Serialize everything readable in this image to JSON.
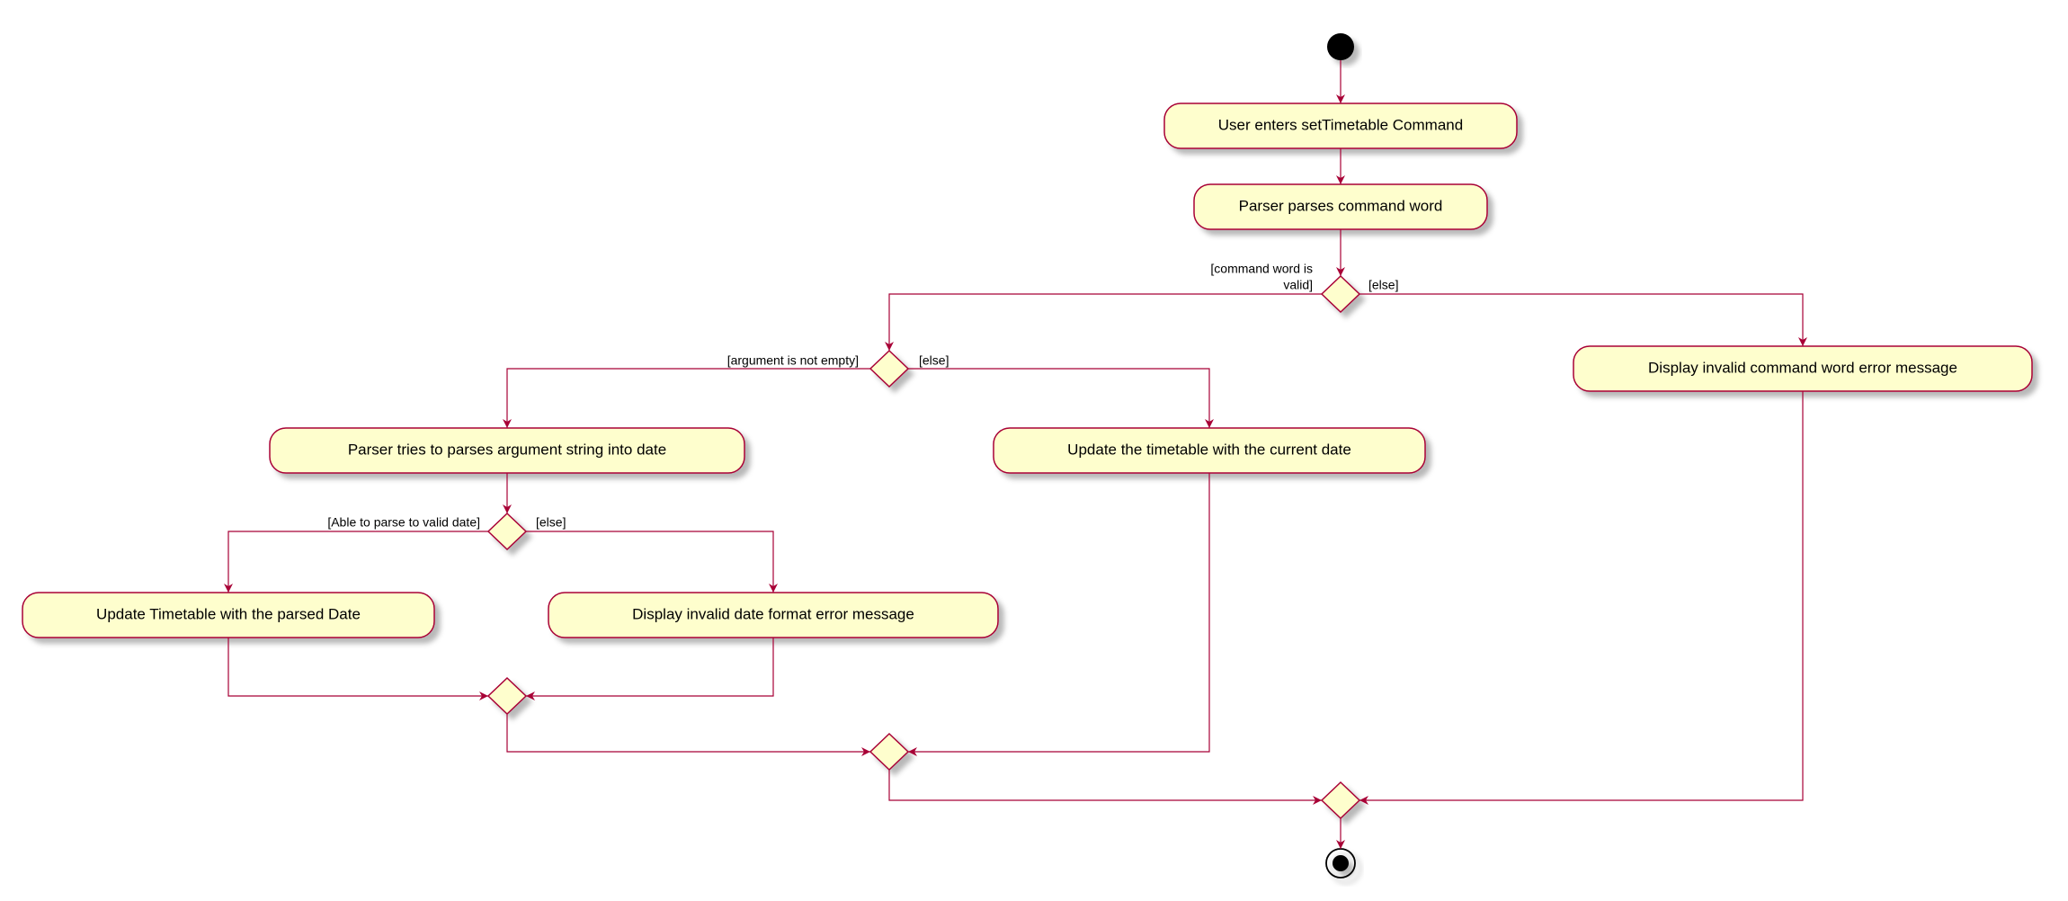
{
  "nodes": {
    "n1": "User enters setTimetable Command",
    "n2": "Parser parses command word",
    "n3": "Parser tries to parses argument string into date",
    "n4": "Update the timetable with the current date",
    "n5": "Display invalid command word error message",
    "n6": "Update Timetable with the parsed Date",
    "n7": "Display invalid date format error message"
  },
  "edgeLabels": {
    "d1_left_a": "[command word is",
    "d1_left_b": "valid]",
    "d1_right": "[else]",
    "d2_left": "[argument is not empty]",
    "d2_right": "[else]",
    "d3_left": "[Able to parse to valid date]",
    "d3_right": "[else]"
  }
}
